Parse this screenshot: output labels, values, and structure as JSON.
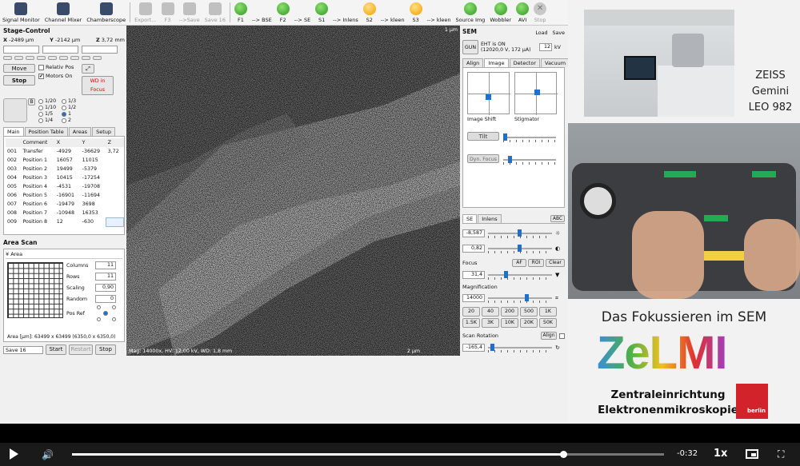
{
  "toolbar": {
    "items": [
      {
        "label": "Signal Monitor",
        "icon": "signal-monitor-icon",
        "enabled": true
      },
      {
        "label": "Channel Mixer",
        "icon": "channel-mixer-icon",
        "enabled": true
      },
      {
        "label": "Chamberscope",
        "icon": "chamberscope-icon",
        "enabled": true
      },
      {
        "label": "Export...",
        "icon": "export-icon",
        "enabled": false
      },
      {
        "label": "F3",
        "icon": "save-icon",
        "enabled": false
      },
      {
        "label": "-->Save",
        "icon": "save-icon",
        "enabled": false
      },
      {
        "label": "Save 16",
        "icon": "save16-icon",
        "enabled": false
      },
      {
        "label": "F1",
        "icon": "play-icon",
        "enabled": true
      },
      {
        "label": "--> BSE",
        "icon": "",
        "enabled": true
      },
      {
        "label": "F2",
        "icon": "play-icon",
        "enabled": true
      },
      {
        "label": "--> SE",
        "icon": "",
        "enabled": true
      },
      {
        "label": "S1",
        "icon": "play-icon",
        "enabled": true
      },
      {
        "label": "--> Inlens",
        "icon": "",
        "enabled": true
      },
      {
        "label": "S2",
        "icon": "search-icon",
        "enabled": true
      },
      {
        "label": "--> kleen",
        "icon": "",
        "enabled": true
      },
      {
        "label": "S3",
        "icon": "search-icon",
        "enabled": true
      },
      {
        "label": "--> kleen",
        "icon": "",
        "enabled": true
      },
      {
        "label": "Source Img",
        "icon": "play-icon",
        "enabled": true
      },
      {
        "label": "Wobbler",
        "icon": "play-icon",
        "enabled": true
      },
      {
        "label": "AVI",
        "icon": "avi-icon",
        "enabled": true
      },
      {
        "label": "Stop",
        "icon": "stop-icon",
        "enabled": false
      }
    ]
  },
  "stage": {
    "title": "Stage-Control",
    "x_label": "X",
    "x_val": "-2489 µm",
    "y_label": "Y",
    "y_val": "-2142 µm",
    "z_label": "Z",
    "z_val": "3,72 mm",
    "move": "Move",
    "stop": "Stop",
    "relativ": "Relativ Pos",
    "motors": "Motors On",
    "wd": "WD in Focus",
    "b": "B",
    "steps": [
      "1/20",
      "1/10",
      "1/5",
      "1/4",
      "1/3",
      "1/2",
      "1",
      "2"
    ]
  },
  "tabs_left": [
    "Main",
    "Position Table",
    "Areas",
    "Setup"
  ],
  "pos_table": {
    "headers": [
      "",
      "Comment",
      "X",
      "Y",
      "Z"
    ],
    "rows": [
      [
        "001",
        "Transfer",
        "-4929",
        "-36629",
        "3,72"
      ],
      [
        "002",
        "Position 1",
        "16057",
        "11015",
        ""
      ],
      [
        "003",
        "Position 2",
        "19499",
        "-5379",
        ""
      ],
      [
        "004",
        "Position 3",
        "10415",
        "-17254",
        ""
      ],
      [
        "005",
        "Position 4",
        "-4531",
        "-19708",
        ""
      ],
      [
        "006",
        "Position 5",
        "-16901",
        "-11694",
        ""
      ],
      [
        "007",
        "Position 6",
        "-19479",
        "3698",
        ""
      ],
      [
        "008",
        "Position 7",
        "-10948",
        "16353",
        ""
      ],
      [
        "009",
        "Position 8",
        "12",
        "-630",
        ""
      ]
    ]
  },
  "area": {
    "title": "Area Scan",
    "sub": "Area",
    "columns_l": "Columns",
    "columns": "11",
    "rows_l": "Rows",
    "rows": "11",
    "scaling_l": "Scaling",
    "scaling": "0,90",
    "random_l": "Random",
    "random": "0",
    "posref": "Pos Ref",
    "size": "Area [µm]: 63499 x 63499 (6350,0 x 6350,0)",
    "save": "Save 16",
    "start": "Start",
    "restart": "Restart",
    "stop": "Stop"
  },
  "image_overlay": {
    "top": "1 µm",
    "bottom_left": "Mag: 14000x, HV: 12,00 kV, WD: 1,8 mm",
    "bottom_right": "2 µm"
  },
  "sem": {
    "title": "SEM",
    "load": "Load",
    "save": "Save",
    "gun": "GUN",
    "eht": "EHT is ON",
    "eht2": "(12020,0 V, 172 µA)",
    "kv": "12",
    "kv_unit": "kV",
    "tabs": [
      "Align",
      "Image",
      "Detector",
      "Vacuum"
    ],
    "image_shift": "Image Shift",
    "stigmator": "Stigmator",
    "tilt": "Tilt",
    "dyn_focus": "Dyn. Focus",
    "det_tabs": [
      "SE",
      "Inlens"
    ],
    "abc": "ABC",
    "brightness": "-8,587",
    "contrast": "0,82",
    "focus": "Focus",
    "af": "AF",
    "roi": "ROI",
    "clear": "Clear",
    "focus_val": "31,4",
    "magnification": "Magnification",
    "mag_val": "14000",
    "mag_buttons": [
      "20",
      "40",
      "200",
      "500",
      "1K",
      "1.5K",
      "3K",
      "10K",
      "20K",
      "50K"
    ],
    "scan_rot": "Scan Rotation",
    "align": "Align",
    "rot_val": "-165,4"
  },
  "video": {
    "title_r1": "ZEISS",
    "title_r2": "Gemini",
    "title_r3": "LEO 982",
    "heading": "Das Fokussieren im SEM",
    "logo": "ZeLMI",
    "line1": "Zentraleinrichtung",
    "line2": "Elektronenmikroskopie",
    "badge": "berlin"
  },
  "player": {
    "time": "-0:32",
    "speed": "1x",
    "progress": 0.83
  },
  "colors": {
    "accent": "#1e6fd0",
    "logo_red": "#d2232a"
  }
}
